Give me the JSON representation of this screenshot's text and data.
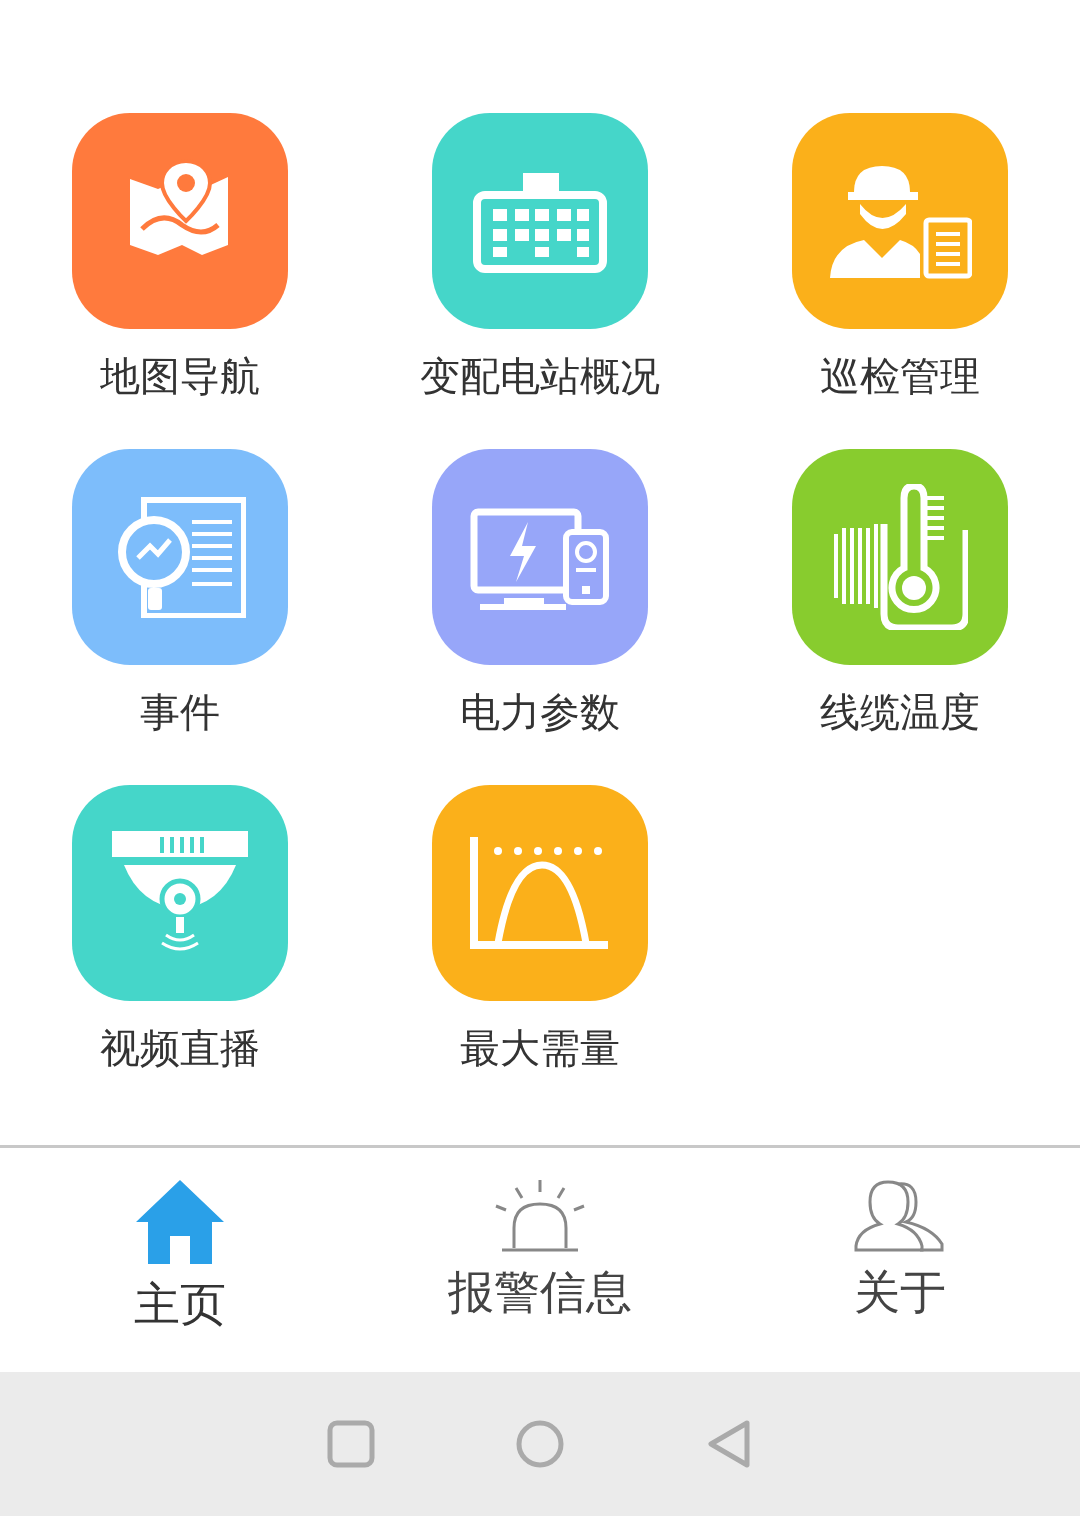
{
  "tiles": [
    {
      "label": "地图导航",
      "color": "#ff7a3d"
    },
    {
      "label": "变配电站概况",
      "color": "#45d6c9"
    },
    {
      "label": "巡检管理",
      "color": "#fbb01a"
    },
    {
      "label": "事件",
      "color": "#7dbdfb"
    },
    {
      "label": "电力参数",
      "color": "#97a6f9"
    },
    {
      "label": "线缆温度",
      "color": "#88cc2e"
    },
    {
      "label": "视频直播",
      "color": "#45d6c9"
    },
    {
      "label": "最大需量",
      "color": "#fbb01a"
    }
  ],
  "bottom_nav": [
    {
      "label": "主页",
      "selected": true
    },
    {
      "label": "报警信息",
      "selected": false
    },
    {
      "label": "关于",
      "selected": false
    }
  ]
}
